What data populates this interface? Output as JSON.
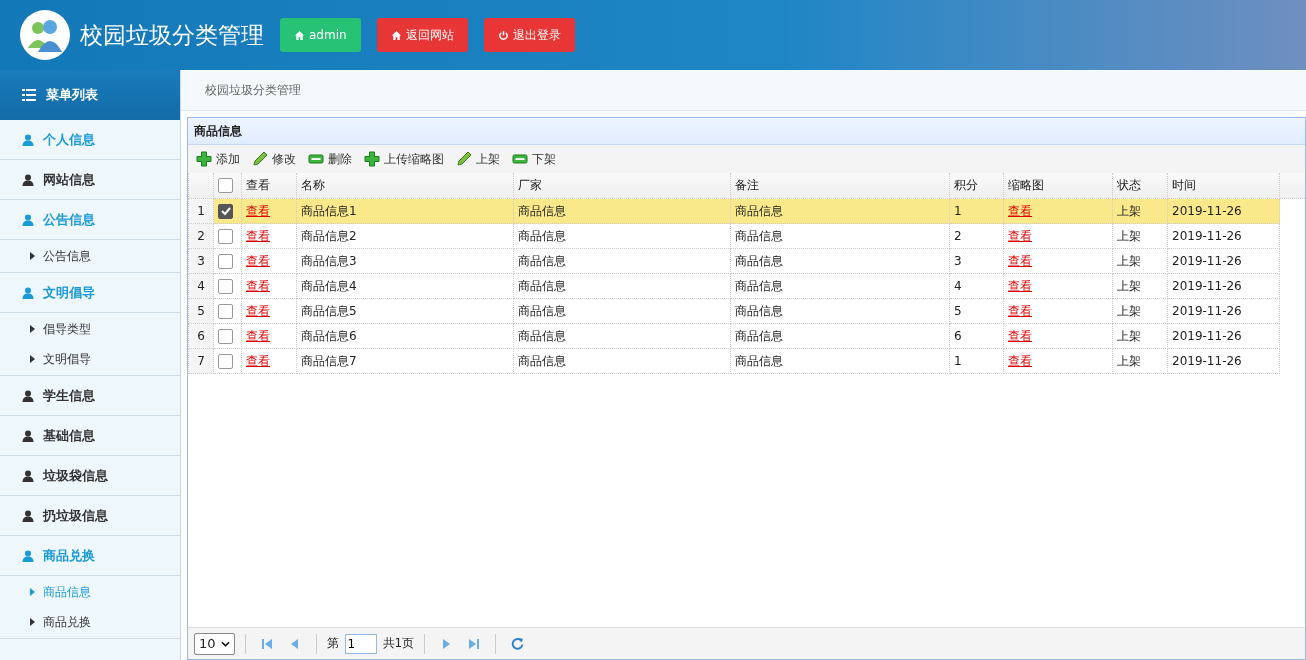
{
  "header": {
    "title": "校园垃圾分类管理",
    "buttons": [
      {
        "kind": "user",
        "label": "admin"
      },
      {
        "kind": "home",
        "label": "返回网站"
      },
      {
        "kind": "logout",
        "label": "退出登录"
      }
    ]
  },
  "sidebar": {
    "title": "菜单列表",
    "sections": [
      {
        "label": "个人信息",
        "expanded": true
      },
      {
        "label": "网站信息",
        "expanded": false
      },
      {
        "label": "公告信息",
        "expanded": true,
        "children": [
          {
            "label": "公告信息",
            "selected": false
          }
        ]
      },
      {
        "label": "文明倡导",
        "expanded": true,
        "children": [
          {
            "label": "倡导类型",
            "selected": false
          },
          {
            "label": "文明倡导",
            "selected": false
          }
        ]
      },
      {
        "label": "学生信息",
        "expanded": false
      },
      {
        "label": "基础信息",
        "expanded": false
      },
      {
        "label": "垃圾袋信息",
        "expanded": false
      },
      {
        "label": "扔垃圾信息",
        "expanded": false
      },
      {
        "label": "商品兑换",
        "expanded": true,
        "children": [
          {
            "label": "商品信息",
            "selected": true
          },
          {
            "label": "商品兑换",
            "selected": false
          }
        ]
      }
    ]
  },
  "breadcrumb": "校园垃圾分类管理",
  "panel": {
    "title": "商品信息",
    "toolbar": [
      {
        "kind": "add",
        "label": "添加"
      },
      {
        "kind": "edit",
        "label": "修改"
      },
      {
        "kind": "remove",
        "label": "删除"
      },
      {
        "kind": "add",
        "label": "上传缩略图"
      },
      {
        "kind": "edit",
        "label": "上架"
      },
      {
        "kind": "remove",
        "label": "下架"
      }
    ],
    "table": {
      "select_all_checked": false,
      "columns": [
        "查看",
        "名称",
        "厂家",
        "备注",
        "积分",
        "缩略图",
        "状态",
        "时间"
      ],
      "rows": [
        {
          "index": "1",
          "selected": true,
          "view": "查看",
          "name": "商品信息1",
          "maker": "商品信息",
          "note": "商品信息",
          "points": "1",
          "thumb": "查看",
          "status": "上架",
          "time": "2019-11-26"
        },
        {
          "index": "2",
          "selected": false,
          "view": "查看",
          "name": "商品信息2",
          "maker": "商品信息",
          "note": "商品信息",
          "points": "2",
          "thumb": "查看",
          "status": "上架",
          "time": "2019-11-26"
        },
        {
          "index": "3",
          "selected": false,
          "view": "查看",
          "name": "商品信息3",
          "maker": "商品信息",
          "note": "商品信息",
          "points": "3",
          "thumb": "查看",
          "status": "上架",
          "time": "2019-11-26"
        },
        {
          "index": "4",
          "selected": false,
          "view": "查看",
          "name": "商品信息4",
          "maker": "商品信息",
          "note": "商品信息",
          "points": "4",
          "thumb": "查看",
          "status": "上架",
          "time": "2019-11-26"
        },
        {
          "index": "5",
          "selected": false,
          "view": "查看",
          "name": "商品信息5",
          "maker": "商品信息",
          "note": "商品信息",
          "points": "5",
          "thumb": "查看",
          "status": "上架",
          "time": "2019-11-26"
        },
        {
          "index": "6",
          "selected": false,
          "view": "查看",
          "name": "商品信息6",
          "maker": "商品信息",
          "note": "商品信息",
          "points": "6",
          "thumb": "查看",
          "status": "上架",
          "time": "2019-11-26"
        },
        {
          "index": "7",
          "selected": false,
          "view": "查看",
          "name": "商品信息7",
          "maker": "商品信息",
          "note": "商品信息",
          "points": "1",
          "thumb": "查看",
          "status": "上架",
          "time": "2019-11-26"
        }
      ]
    },
    "pager": {
      "page_size": "10",
      "page_prefix": "第",
      "page": "1",
      "page_total": "共1页"
    }
  }
}
